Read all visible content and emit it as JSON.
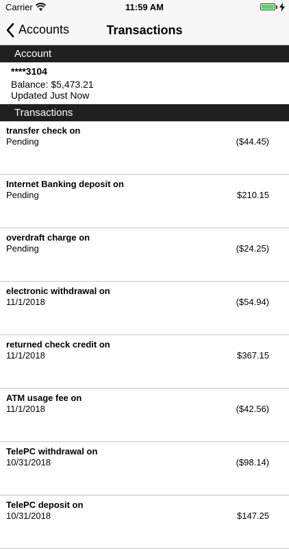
{
  "status_bar": {
    "carrier": "Carrier",
    "time": "11:59 AM"
  },
  "nav": {
    "back_label": "Accounts",
    "title": "Transactions"
  },
  "account_section": {
    "header": "Account",
    "number": "****3104",
    "balance": "Balance: $5,473.21",
    "updated": "Updated Just Now"
  },
  "transactions_section": {
    "header": "Transactions",
    "items": [
      {
        "description": "transfer check on",
        "date": "Pending",
        "amount": "($44.45)"
      },
      {
        "description": "Internet Banking deposit on",
        "date": "Pending",
        "amount": "$210.15"
      },
      {
        "description": "overdraft charge on",
        "date": "Pending",
        "amount": "($24.25)"
      },
      {
        "description": "electronic withdrawal on",
        "date": "11/1/2018",
        "amount": "($54.94)"
      },
      {
        "description": "returned check credit on",
        "date": "11/1/2018",
        "amount": "$367.15"
      },
      {
        "description": "ATM usage fee on",
        "date": "11/1/2018",
        "amount": "($42.56)"
      },
      {
        "description": "TelePC withdrawal on",
        "date": "10/31/2018",
        "amount": "($98.14)"
      },
      {
        "description": "TelePC deposit on",
        "date": "10/31/2018",
        "amount": "$147.25"
      }
    ]
  },
  "icons": {
    "wifi": "wifi-icon",
    "battery": "battery-icon",
    "charging": "charging-bolt-icon",
    "back": "chevron-left-icon"
  },
  "colors": {
    "section_header_bg": "#202020",
    "battery_fill": "#4cd964"
  }
}
